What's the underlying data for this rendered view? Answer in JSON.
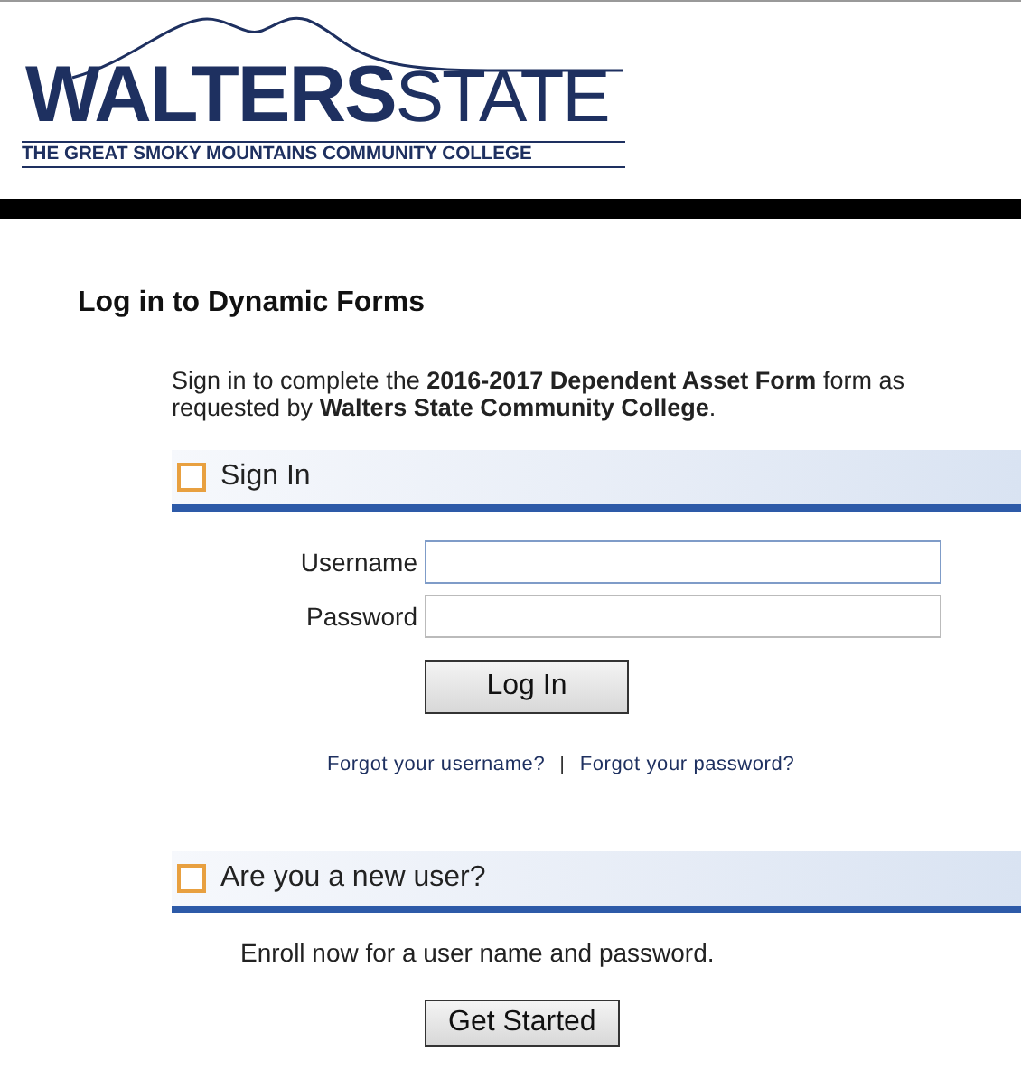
{
  "logo": {
    "word_bold": "WALTERS",
    "word_light": "STATE",
    "tagline": "THE GREAT SMOKY MOUNTAINS COMMUNITY COLLEGE"
  },
  "heading": "Log in to Dynamic Forms",
  "intro": "Sign in to complete the **2016-2017 Dependent Asset Form** form as requested by **Walters State Community College**.",
  "sign_in": {
    "title": "Sign In",
    "fields": [
      {
        "label": "Username",
        "focused": true
      },
      {
        "label": "Password",
        "focused": false
      }
    ],
    "button": "Log In",
    "links": [
      "Forgot your username?",
      "Forgot your password?"
    ],
    "separator": "|"
  },
  "new_user": {
    "title": "Are you a new user?",
    "text": "Enroll now for a user name and password.",
    "button": "Get Started"
  }
}
